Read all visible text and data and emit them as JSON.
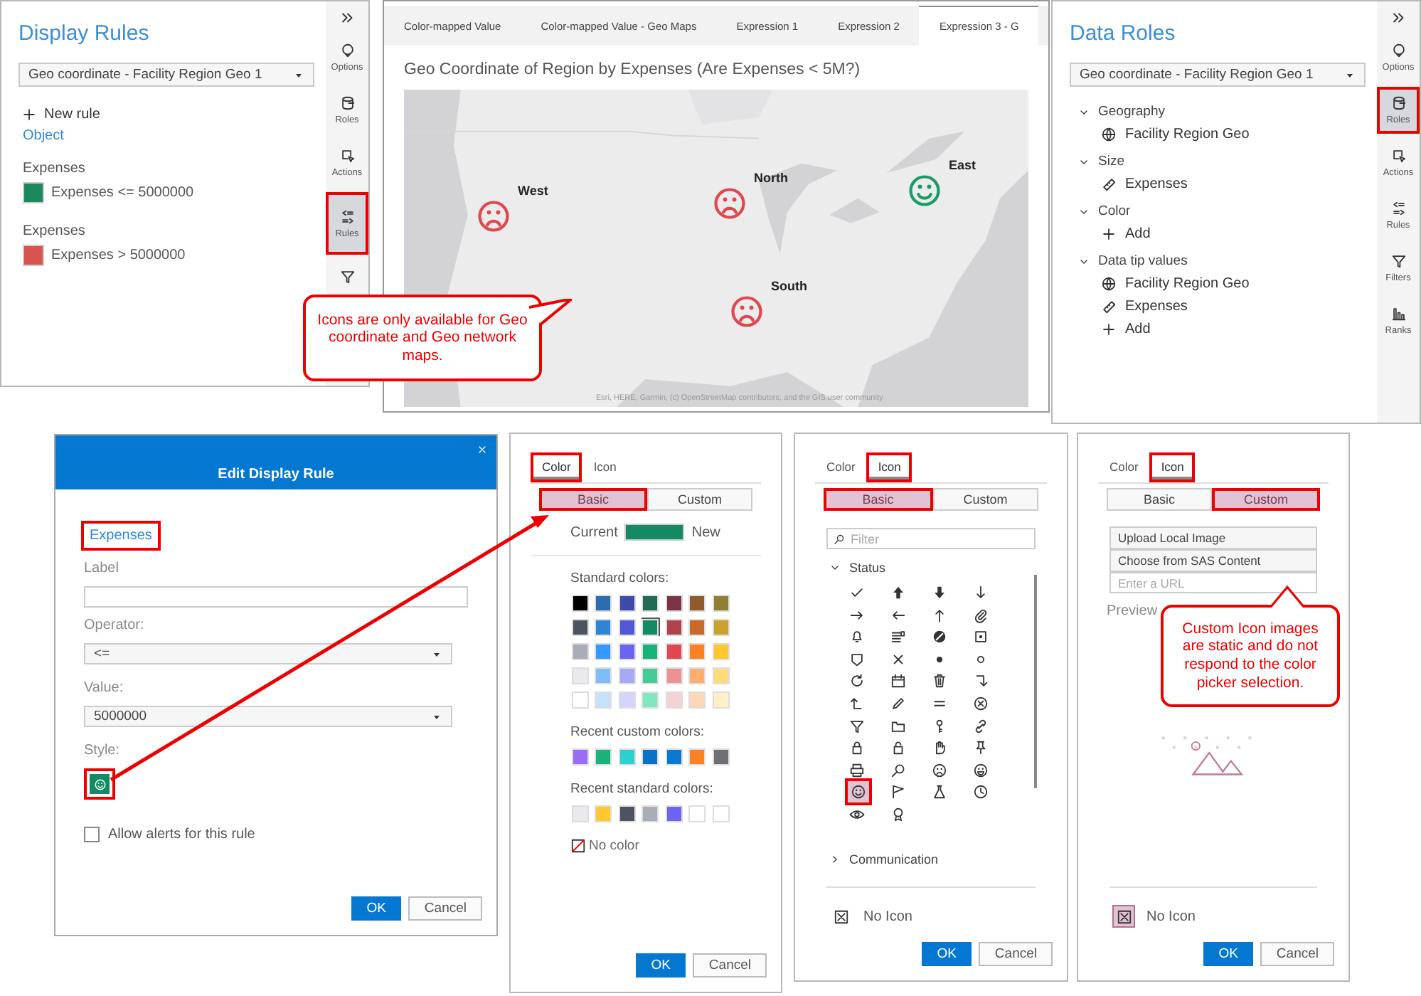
{
  "display_rules_panel": {
    "title": "Display Rules",
    "object_select": "Geo coordinate - Facility Region Geo 1",
    "new_rule": "New rule",
    "object_link": "Object",
    "rules": [
      {
        "heading": "Expenses",
        "label": "Expenses <= 5000000",
        "color": "#1a8a5e"
      },
      {
        "heading": "Expenses",
        "label": "Expenses > 5000000",
        "color": "#d9534f"
      }
    ],
    "sidebar": [
      {
        "kind": "options",
        "label": "Options",
        "selected": false,
        "marked": false
      },
      {
        "kind": "roles",
        "label": "Roles",
        "selected": false,
        "marked": false
      },
      {
        "kind": "actions",
        "label": "Actions",
        "selected": false,
        "marked": false
      },
      {
        "kind": "rules",
        "label": "Rules",
        "selected": true,
        "marked": true
      },
      {
        "kind": "filters",
        "selected": false,
        "marked": false
      }
    ]
  },
  "report": {
    "tabs": [
      {
        "label": "Color-mapped Value",
        "selected": false
      },
      {
        "label": "Color-mapped Value - Geo Maps",
        "selected": false
      },
      {
        "label": "Expression 1",
        "selected": false
      },
      {
        "label": "Expression 2",
        "selected": false
      },
      {
        "label": "Expression 3 - G",
        "selected": true
      }
    ],
    "title": "Geo Coordinate of Region by Expenses (Are Expenses < 5M?)",
    "map": {
      "kind": "picture",
      "markers": [
        {
          "label": "West",
          "kind": "sad",
          "color": "#e0474f"
        },
        {
          "label": "North",
          "kind": "sad",
          "color": "#e0474f"
        },
        {
          "label": "East",
          "kind": "happy",
          "color": "#1a9a64"
        },
        {
          "label": "South",
          "kind": "sad",
          "color": "#e0474f"
        }
      ],
      "attribution": "Esri, HERE, Garmin, (c) OpenStreetMap contributors, and the GIS user community"
    }
  },
  "data_roles_panel": {
    "title": "Data Roles",
    "object_select": "Geo coordinate - Facility Region Geo 1",
    "roles": [
      {
        "label": "Geography",
        "expanded": true,
        "items": [
          {
            "kind": "geo",
            "label": "Facility Region Geo"
          }
        ]
      },
      {
        "label": "Size",
        "expanded": true,
        "items": [
          {
            "kind": "measure",
            "label": "Expenses"
          }
        ]
      },
      {
        "label": "Color",
        "expanded": true,
        "items": [
          {
            "kind": "add",
            "label": "Add"
          }
        ]
      },
      {
        "label": "Data tip values",
        "expanded": true,
        "items": [
          {
            "kind": "geo",
            "label": "Facility Region Geo"
          },
          {
            "kind": "measure",
            "label": "Expenses"
          },
          {
            "kind": "add",
            "label": "Add"
          }
        ]
      }
    ],
    "sidebar": [
      {
        "kind": "options",
        "label": "Options",
        "selected": false,
        "marked": false
      },
      {
        "kind": "roles",
        "label": "Roles",
        "selected": true,
        "marked": true
      },
      {
        "kind": "actions",
        "label": "Actions",
        "selected": false,
        "marked": false
      },
      {
        "kind": "rules",
        "label": "Rules",
        "selected": false,
        "marked": false
      },
      {
        "kind": "filters",
        "label": "Filters",
        "selected": false,
        "marked": false
      },
      {
        "kind": "ranks",
        "label": "Ranks",
        "selected": false,
        "marked": false
      }
    ]
  },
  "edit_dialog": {
    "title": "Edit Display Rule",
    "field_link": {
      "text": "Expenses",
      "marked": true
    },
    "label_field": {
      "label": "Label"
    },
    "operator": {
      "label": "Operator:",
      "value": "<="
    },
    "value": {
      "label": "Value:",
      "value": "5000000"
    },
    "style": {
      "label": "Style:",
      "color": "#138a64",
      "marked": true
    },
    "alert": {
      "label": "Allow alerts for this rule",
      "checked": false
    },
    "buttons": [
      "OK",
      "Cancel"
    ]
  },
  "color_picker": {
    "tabs": [
      {
        "label": "Color",
        "selected": true,
        "marked": true
      },
      {
        "label": "Icon",
        "selected": false,
        "marked": false
      }
    ],
    "modes": [
      {
        "label": "Basic",
        "selected": true,
        "marked": true
      },
      {
        "label": "Custom",
        "selected": false,
        "marked": false
      }
    ],
    "current_label": "Current",
    "new_label": "New",
    "standard_label": "Standard colors:",
    "standard_colors": [
      {
        "color": "#000000",
        "selected": false
      },
      {
        "color": "#2a6ead",
        "selected": false
      },
      {
        "color": "#3f4aa8",
        "selected": false
      },
      {
        "color": "#1f6b55",
        "selected": false
      },
      {
        "color": "#7b3346",
        "selected": false
      },
      {
        "color": "#8f5a2e",
        "selected": false
      },
      {
        "color": "#8f7f35",
        "selected": false
      },
      {
        "color": "#4d5360",
        "selected": false
      },
      {
        "color": "#2f84d6",
        "selected": false
      },
      {
        "color": "#5158d6",
        "selected": false
      },
      {
        "color": "#138a64",
        "selected": true
      },
      {
        "color": "#b0424d",
        "selected": false
      },
      {
        "color": "#c96a2a",
        "selected": false
      },
      {
        "color": "#c9a22e",
        "selected": false
      },
      {
        "color": "#a9adb8",
        "selected": false
      },
      {
        "color": "#3399ff",
        "selected": false
      },
      {
        "color": "#6c63f2",
        "selected": false
      },
      {
        "color": "#17b27a",
        "selected": false
      },
      {
        "color": "#e0474f",
        "selected": false
      },
      {
        "color": "#ff8126",
        "selected": false
      },
      {
        "color": "#ffc82e",
        "selected": false
      },
      {
        "color": "#e8eaed",
        "selected": false
      },
      {
        "color": "#80bdf7",
        "selected": false
      },
      {
        "color": "#a8a8f8",
        "selected": false
      },
      {
        "color": "#44cc96",
        "selected": false
      },
      {
        "color": "#ec9194",
        "selected": false
      },
      {
        "color": "#ffad70",
        "selected": false
      },
      {
        "color": "#ffdb7a",
        "selected": false
      },
      {
        "color": "#ffffff",
        "selected": false
      },
      {
        "color": "#c6e1f9",
        "selected": false
      },
      {
        "color": "#d4d4fc",
        "selected": false
      },
      {
        "color": "#80e7c1",
        "selected": false
      },
      {
        "color": "#f5d2d3",
        "selected": false
      },
      {
        "color": "#ffd6b8",
        "selected": false
      },
      {
        "color": "#fff0c8",
        "selected": false
      }
    ],
    "recent_custom_label": "Recent custom colors:",
    "recent_custom_colors": [
      {
        "color": "#9b6cf5"
      },
      {
        "color": "#19b27b"
      },
      {
        "color": "#2dcfcf"
      },
      {
        "color": "#0a72c4"
      },
      {
        "color": "#0a79d0"
      },
      {
        "color": "#ff8126"
      },
      {
        "color": "#6e7075"
      }
    ],
    "recent_standard_label": "Recent standard colors:",
    "recent_standard_colors": [
      {
        "color": "#e8eaed"
      },
      {
        "color": "#ffc82e"
      },
      {
        "color": "#4d5360"
      },
      {
        "color": "#a9adb8"
      },
      {
        "color": "#6c63f2"
      },
      {
        "color": "#ffffff"
      },
      {
        "color": "#ffffff"
      }
    ],
    "no_color": "No color",
    "buttons": [
      "OK",
      "Cancel"
    ]
  },
  "icon_picker_basic": {
    "tabs": [
      {
        "label": "Color",
        "selected": false,
        "marked": false
      },
      {
        "label": "Icon",
        "selected": true,
        "marked": true
      }
    ],
    "modes": [
      {
        "label": "Basic",
        "selected": true,
        "marked": true
      },
      {
        "label": "Custom",
        "selected": false,
        "marked": false
      }
    ],
    "filter_placeholder": "Filter",
    "groups": [
      {
        "label": "Status",
        "expanded": true,
        "icons": [
          {
            "kind": "check",
            "selected": false,
            "marked": false
          },
          {
            "kind": "arrow-up-bold",
            "selected": false,
            "marked": false
          },
          {
            "kind": "arrow-down-bold",
            "selected": false,
            "marked": false
          },
          {
            "kind": "arrow-down",
            "selected": false,
            "marked": false
          },
          {
            "kind": "arrow-right",
            "selected": false,
            "marked": false
          },
          {
            "kind": "arrow-left",
            "selected": false,
            "marked": false
          },
          {
            "kind": "arrow-up",
            "selected": false,
            "marked": false
          },
          {
            "kind": "paperclip",
            "selected": false,
            "marked": false
          },
          {
            "kind": "bell",
            "selected": false,
            "marked": false
          },
          {
            "kind": "list",
            "selected": false,
            "marked": false
          },
          {
            "kind": "block",
            "selected": false,
            "marked": false
          },
          {
            "kind": "square-dot",
            "selected": false,
            "marked": false
          },
          {
            "kind": "badge",
            "selected": false,
            "marked": false
          },
          {
            "kind": "x",
            "selected": false,
            "marked": false
          },
          {
            "kind": "dot",
            "selected": false,
            "marked": false
          },
          {
            "kind": "circle",
            "selected": false,
            "marked": false
          },
          {
            "kind": "refresh",
            "selected": false,
            "marked": false
          },
          {
            "kind": "calendar",
            "selected": false,
            "marked": false
          },
          {
            "kind": "trash",
            "selected": false,
            "marked": false
          },
          {
            "kind": "turn-down",
            "selected": false,
            "marked": false
          },
          {
            "kind": "turn-up",
            "selected": false,
            "marked": false
          },
          {
            "kind": "pencil",
            "selected": false,
            "marked": false
          },
          {
            "kind": "equals",
            "selected": false,
            "marked": false
          },
          {
            "kind": "circle-x",
            "selected": false,
            "marked": false
          },
          {
            "kind": "filter",
            "selected": false,
            "marked": false
          },
          {
            "kind": "folder",
            "selected": false,
            "marked": false
          },
          {
            "kind": "key",
            "selected": false,
            "marked": false
          },
          {
            "kind": "link",
            "selected": false,
            "marked": false
          },
          {
            "kind": "lock",
            "selected": false,
            "marked": false
          },
          {
            "kind": "unlock",
            "selected": false,
            "marked": false
          },
          {
            "kind": "hand",
            "selected": false,
            "marked": false
          },
          {
            "kind": "pin",
            "selected": false,
            "marked": false
          },
          {
            "kind": "printer",
            "selected": false,
            "marked": false
          },
          {
            "kind": "search",
            "selected": false,
            "marked": false
          },
          {
            "kind": "sad",
            "selected": false,
            "marked": false
          },
          {
            "kind": "grin",
            "selected": false,
            "marked": false
          },
          {
            "kind": "happy",
            "selected": true,
            "marked": true
          },
          {
            "kind": "flag",
            "selected": false,
            "marked": false
          },
          {
            "kind": "flask",
            "selected": false,
            "marked": false
          },
          {
            "kind": "clock",
            "selected": false,
            "marked": false
          },
          {
            "kind": "eye",
            "selected": false,
            "marked": false
          },
          {
            "kind": "award",
            "selected": false,
            "marked": false
          }
        ]
      },
      {
        "label": "Communication",
        "expanded": false
      }
    ],
    "no_icon": {
      "label": "No Icon",
      "selected": false
    },
    "buttons": [
      "OK",
      "Cancel"
    ]
  },
  "icon_picker_custom": {
    "tabs": [
      {
        "label": "Color",
        "selected": false,
        "marked": false
      },
      {
        "label": "Icon",
        "selected": true,
        "marked": true
      }
    ],
    "modes": [
      {
        "label": "Basic",
        "selected": false,
        "marked": false
      },
      {
        "label": "Custom",
        "selected": true,
        "marked": true
      }
    ],
    "actions": [
      "Upload Local Image",
      "Choose from SAS Content"
    ],
    "url_placeholder": "Enter a URL",
    "preview_label": "Preview",
    "no_icon": {
      "label": "No Icon",
      "selected": true
    },
    "buttons": [
      "OK",
      "Cancel"
    ]
  },
  "callouts": [
    {
      "text": "Icons are only available for Geo coordinate and Geo network maps."
    },
    {
      "text": "Custom Icon images are static and do not respond to the color picker selection."
    }
  ]
}
